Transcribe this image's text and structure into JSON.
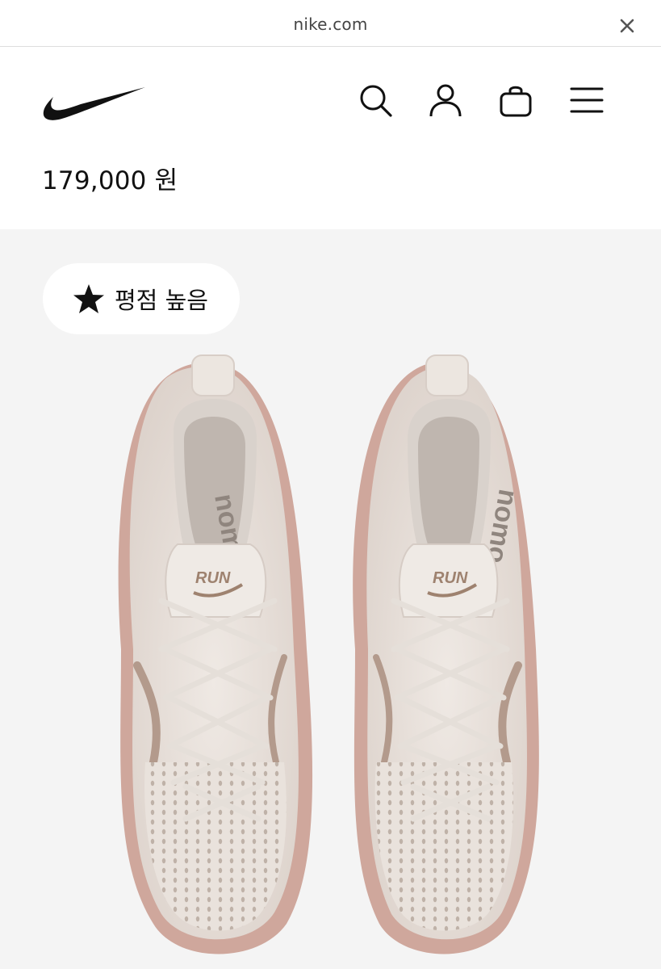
{
  "browser": {
    "url": "nike.com",
    "close_icon": "close-icon"
  },
  "header": {
    "logo": "nike-swoosh-logo",
    "icons": [
      "search-icon",
      "account-icon",
      "bag-icon",
      "menu-icon"
    ]
  },
  "product": {
    "price": "179,000 원",
    "badge": {
      "icon": "star-icon",
      "label": "평점 높음"
    },
    "shoe_tongue_text": "RUN"
  },
  "colors": {
    "background": "#ffffff",
    "product_bg": "#f4f4f4",
    "shoe_main": "#ebe5df",
    "accent_rose": "#c99a8e",
    "text": "#111111"
  }
}
